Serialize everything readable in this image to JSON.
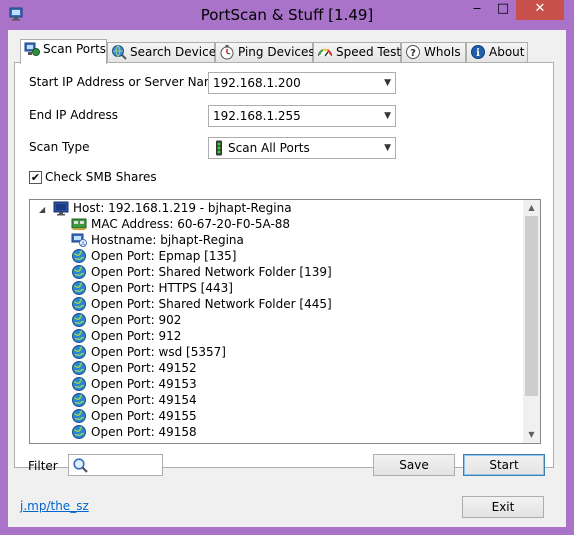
{
  "window": {
    "title": "PortScan & Stuff [1.49]",
    "minimize_glyph": "‒",
    "maximize_glyph": "□",
    "close_glyph": "✕"
  },
  "tabs": [
    {
      "label": "Scan Ports",
      "icon": "network-computer-icon",
      "active": true
    },
    {
      "label": "Search Devices",
      "icon": "globe-search-icon",
      "active": false
    },
    {
      "label": "Ping Devices",
      "icon": "stopwatch-icon",
      "active": false
    },
    {
      "label": "Speed Test",
      "icon": "speedometer-icon",
      "active": false
    },
    {
      "label": "WhoIs",
      "icon": "help-circle-icon",
      "active": false
    },
    {
      "label": "About",
      "icon": "info-icon",
      "active": false
    }
  ],
  "form": {
    "start_ip_label": "Start IP Address or Server Name",
    "start_ip_value": "192.168.1.200",
    "end_ip_label": "End IP Address",
    "end_ip_value": "192.168.1.255",
    "scan_type_label": "Scan Type",
    "scan_type_value": "Scan All Ports",
    "smb_label": "Check SMB Shares",
    "smb_checked": true,
    "smb_check_glyph": "✔",
    "combo_arrow_glyph": "▼"
  },
  "tree": {
    "expander_glyph": "◢",
    "host": {
      "text": "Host: 192.168.1.219 - bjhapt-Regina",
      "icon": "monitor-icon"
    },
    "children": [
      {
        "text": "MAC Address: 60-67-20-F0-5A-88",
        "icon": "network-card-icon"
      },
      {
        "text": "Hostname: bjhapt-Regina",
        "icon": "computer-name-icon"
      },
      {
        "text": "Open Port: Epmap [135]",
        "icon": "globe-icon"
      },
      {
        "text": "Open Port: Shared Network Folder [139]",
        "icon": "globe-icon"
      },
      {
        "text": "Open Port: HTTPS [443]",
        "icon": "globe-icon"
      },
      {
        "text": "Open Port: Shared Network Folder [445]",
        "icon": "globe-icon"
      },
      {
        "text": "Open Port: 902",
        "icon": "globe-icon"
      },
      {
        "text": "Open Port: 912",
        "icon": "globe-icon"
      },
      {
        "text": "Open Port: wsd [5357]",
        "icon": "globe-icon"
      },
      {
        "text": "Open Port: 49152",
        "icon": "globe-icon"
      },
      {
        "text": "Open Port: 49153",
        "icon": "globe-icon"
      },
      {
        "text": "Open Port: 49154",
        "icon": "globe-icon"
      },
      {
        "text": "Open Port: 49155",
        "icon": "globe-icon"
      },
      {
        "text": "Open Port: 49158",
        "icon": "globe-icon"
      }
    ],
    "scroll_up_glyph": "▲",
    "scroll_down_glyph": "▼"
  },
  "filter": {
    "label": "Filter",
    "value": "",
    "icon": "magnifier-icon"
  },
  "buttons": {
    "save": "Save",
    "start": "Start",
    "exit": "Exit"
  },
  "footer": {
    "link": "j.mp/the_sz"
  },
  "colors": {
    "frame": "#a873c9",
    "close": "#c7504a",
    "link": "#0066cc"
  }
}
